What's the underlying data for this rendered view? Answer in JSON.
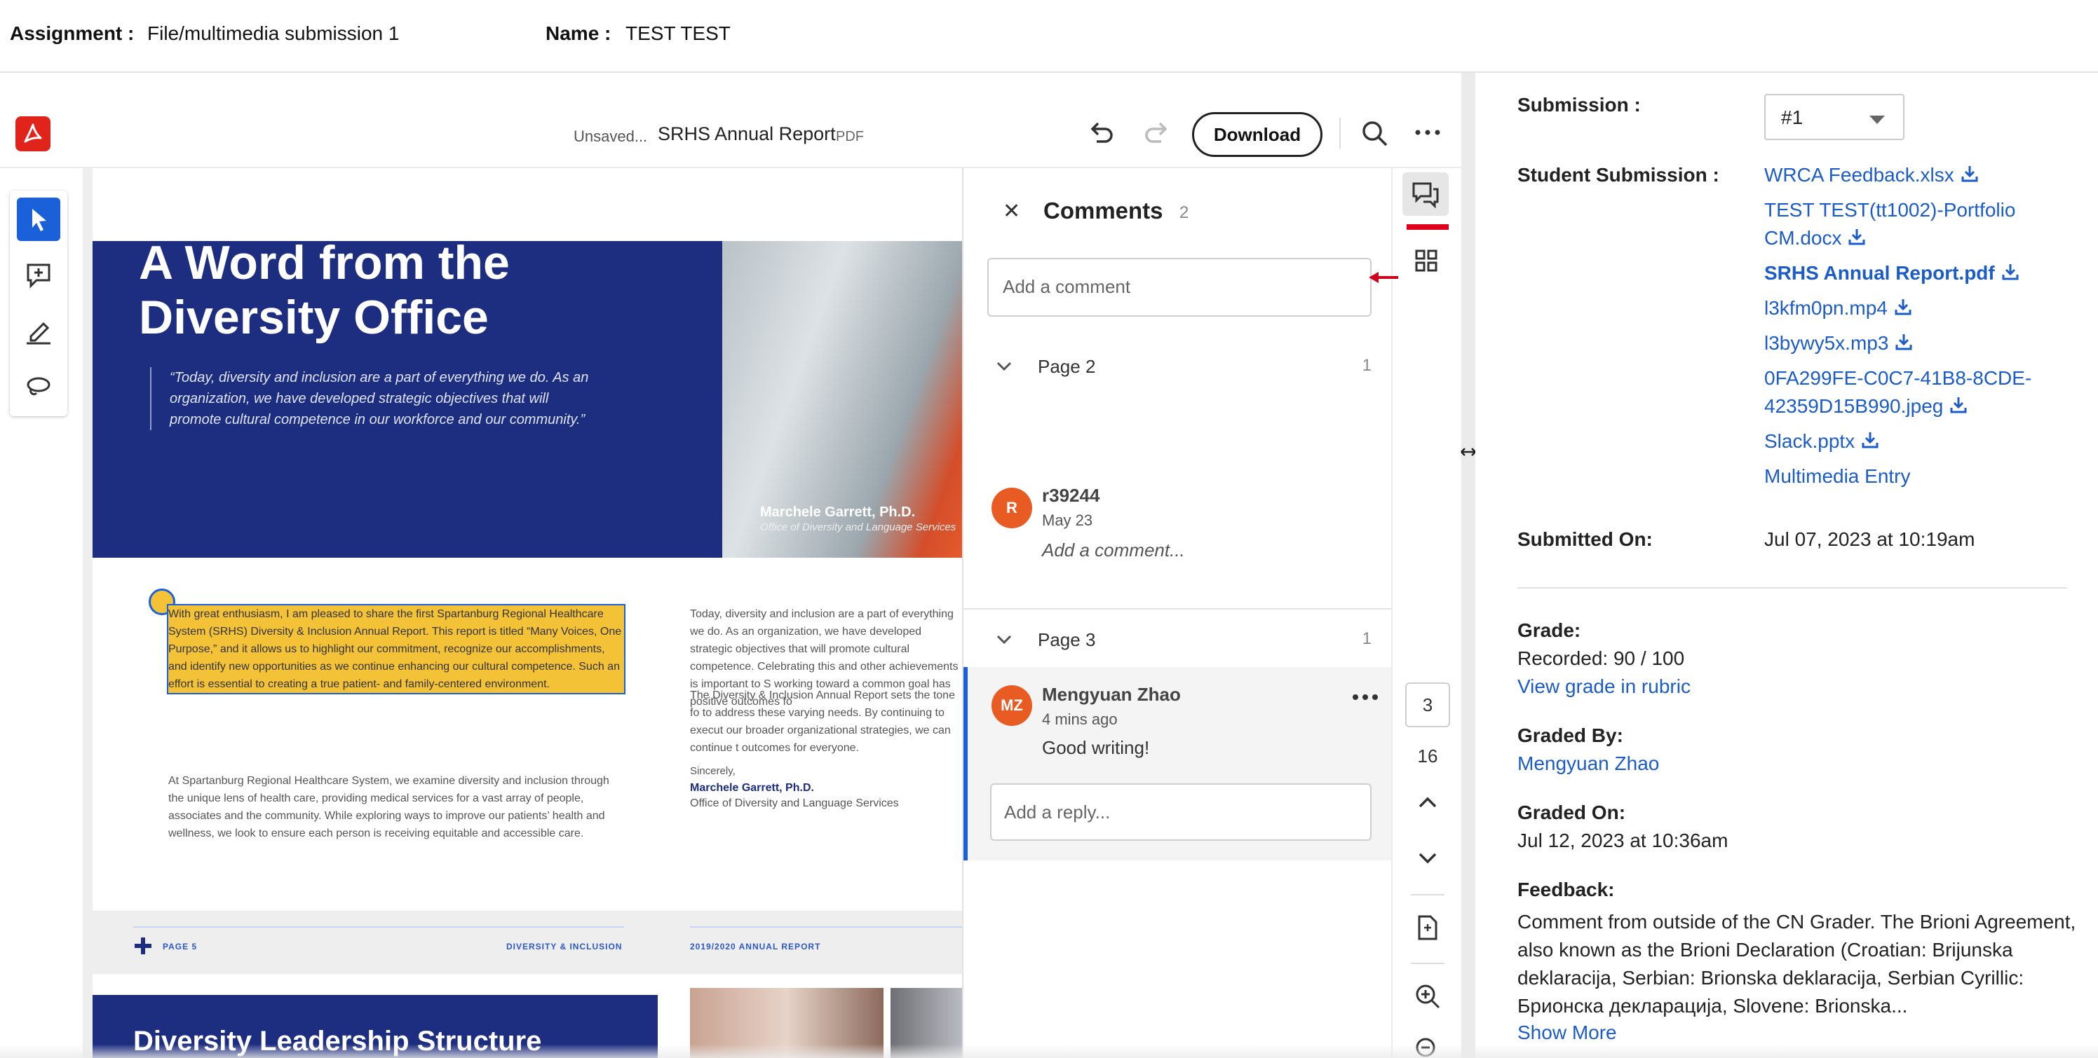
{
  "header": {
    "assignment_label": "Assignment :",
    "assignment_value": "File/multimedia submission 1",
    "name_label": "Name :",
    "name_value": "TEST TEST"
  },
  "viewer": {
    "status": "Unsaved...",
    "document_title": "SRHS Annual Report",
    "document_type": "PDF",
    "download_label": "Download",
    "icons": [
      "acrobat-icon",
      "undo-icon",
      "redo-icon",
      "search-icon",
      "more-icon",
      "select-tool-icon",
      "add-comment-icon",
      "highlight-icon",
      "lasso-icon"
    ]
  },
  "document": {
    "hero_title": "A Word from the Diversity Office",
    "hero_quote": "“Today, diversity and inclusion are a part of everything we do. As an organization, we have developed strategic objectives that will promote cultural competence in our workforce and our community.”",
    "photo_name": "Marchele Garrett, Ph.D.",
    "photo_subtitle": "Office of Diversity and Language Services",
    "highlighted_text": "With great enthusiasm, I am pleased to share the first Spartanburg Regional Healthcare System (SRHS) Diversity & Inclusion Annual Report. This report is titled “Many Voices, One Purpose,” and it allows us to highlight our commitment, recognize our accomplishments, and identify new opportunities as we continue enhancing our cultural competence. Such an effort is essential to creating a true patient- and family-centered environment.",
    "left_paragraph": "At Spartanburg Regional Healthcare System, we examine diversity and inclusion through the unique lens of health care, providing medical services for a vast array of people, associates and the community. While exploring ways to improve our patients’ health and wellness, we look to ensure each person is receiving equitable and accessible care.",
    "right_paragraph_1": "Today, diversity and inclusion are a part of everything we do. As an organization, we have developed strategic objectives that will promote cultural competence. Celebrating this and other achievements is important to S working toward a common goal has positive outcomes fo",
    "right_paragraph_2": "The Diversity & Inclusion Annual Report sets the tone fo to address these varying needs. By continuing to execut our broader organizational strategies, we can continue t outcomes for everyone.",
    "sincerely": "Sincerely,",
    "signature_name": "Marchele Garrett, Ph.D.",
    "signature_office": "Office of Diversity and Language Services",
    "footer_page": "PAGE 5",
    "footer_section": "DIVERSITY & INCLUSION",
    "footer_report": "2019/2020 ANNUAL REPORT",
    "next_page_title": "Diversity Leadership Structure"
  },
  "comments": {
    "title": "Comments",
    "count": "2",
    "add_placeholder": "Add a comment",
    "groups": [
      {
        "label": "Page 2",
        "count": "1",
        "author_initials": "R",
        "author": "r39244",
        "time": "May 23",
        "text": "Add a comment..."
      },
      {
        "label": "Page 3",
        "count": "1",
        "author_initials": "MZ",
        "author": "Mengyuan Zhao",
        "time": "4 mins ago",
        "text": "Good writing!",
        "reply_placeholder": "Add a reply..."
      }
    ]
  },
  "rail": {
    "current_page": "3",
    "total_pages": "16"
  },
  "submission": {
    "submission_label": "Submission :",
    "submission_value": "#1",
    "student_submission_label": "Student Submission :",
    "files": [
      "WRCA Feedback.xlsx",
      "TEST TEST(tt1002)-Portfolio CM.docx",
      "SRHS Annual Report.pdf",
      "l3kfm0pn.mp4",
      "l3bywy5x.mp3",
      "0FA299FE-C0C7-41B8-8CDE-42359D15B990.jpeg",
      "Slack.pptx",
      "Multimedia Entry"
    ],
    "file_display": {
      "f1_line1": "TEST TEST(tt1002)-Portfolio",
      "f1_line2": "CM.docx",
      "f5_line1": "0FA299FE-C0C7-41B8-8CDE-",
      "f5_line2": "42359D15B990.jpeg"
    },
    "submitted_on_label": "Submitted On:",
    "submitted_on_value": "Jul 07, 2023 at 10:19am",
    "grade_label": "Grade:",
    "grade_value": "Recorded: 90 / 100",
    "grade_link": "View grade in rubric",
    "graded_by_label": "Graded By:",
    "graded_by_value": "Mengyuan Zhao",
    "graded_on_label": "Graded On:",
    "graded_on_value": "Jul 12, 2023 at 10:36am",
    "feedback_label": "Feedback:",
    "feedback_text": "Comment from outside of the CN Grader. The Brioni Agreement, also known as the Brioni Declaration (Croatian: Brijunska deklaracija, Serbian: Brionska deklaracija, Serbian Cyrillic: Брионска декларација, Slovene: Brionska...",
    "show_more": "Show More"
  },
  "colors": {
    "accent_blue": "#1a60d8",
    "link_blue": "#1b5cc8",
    "hero_navy": "#1d2d80",
    "highlight_yellow": "#f3c236",
    "acrobat_red": "#e0241b",
    "avatar_orange": "#e85c23"
  }
}
